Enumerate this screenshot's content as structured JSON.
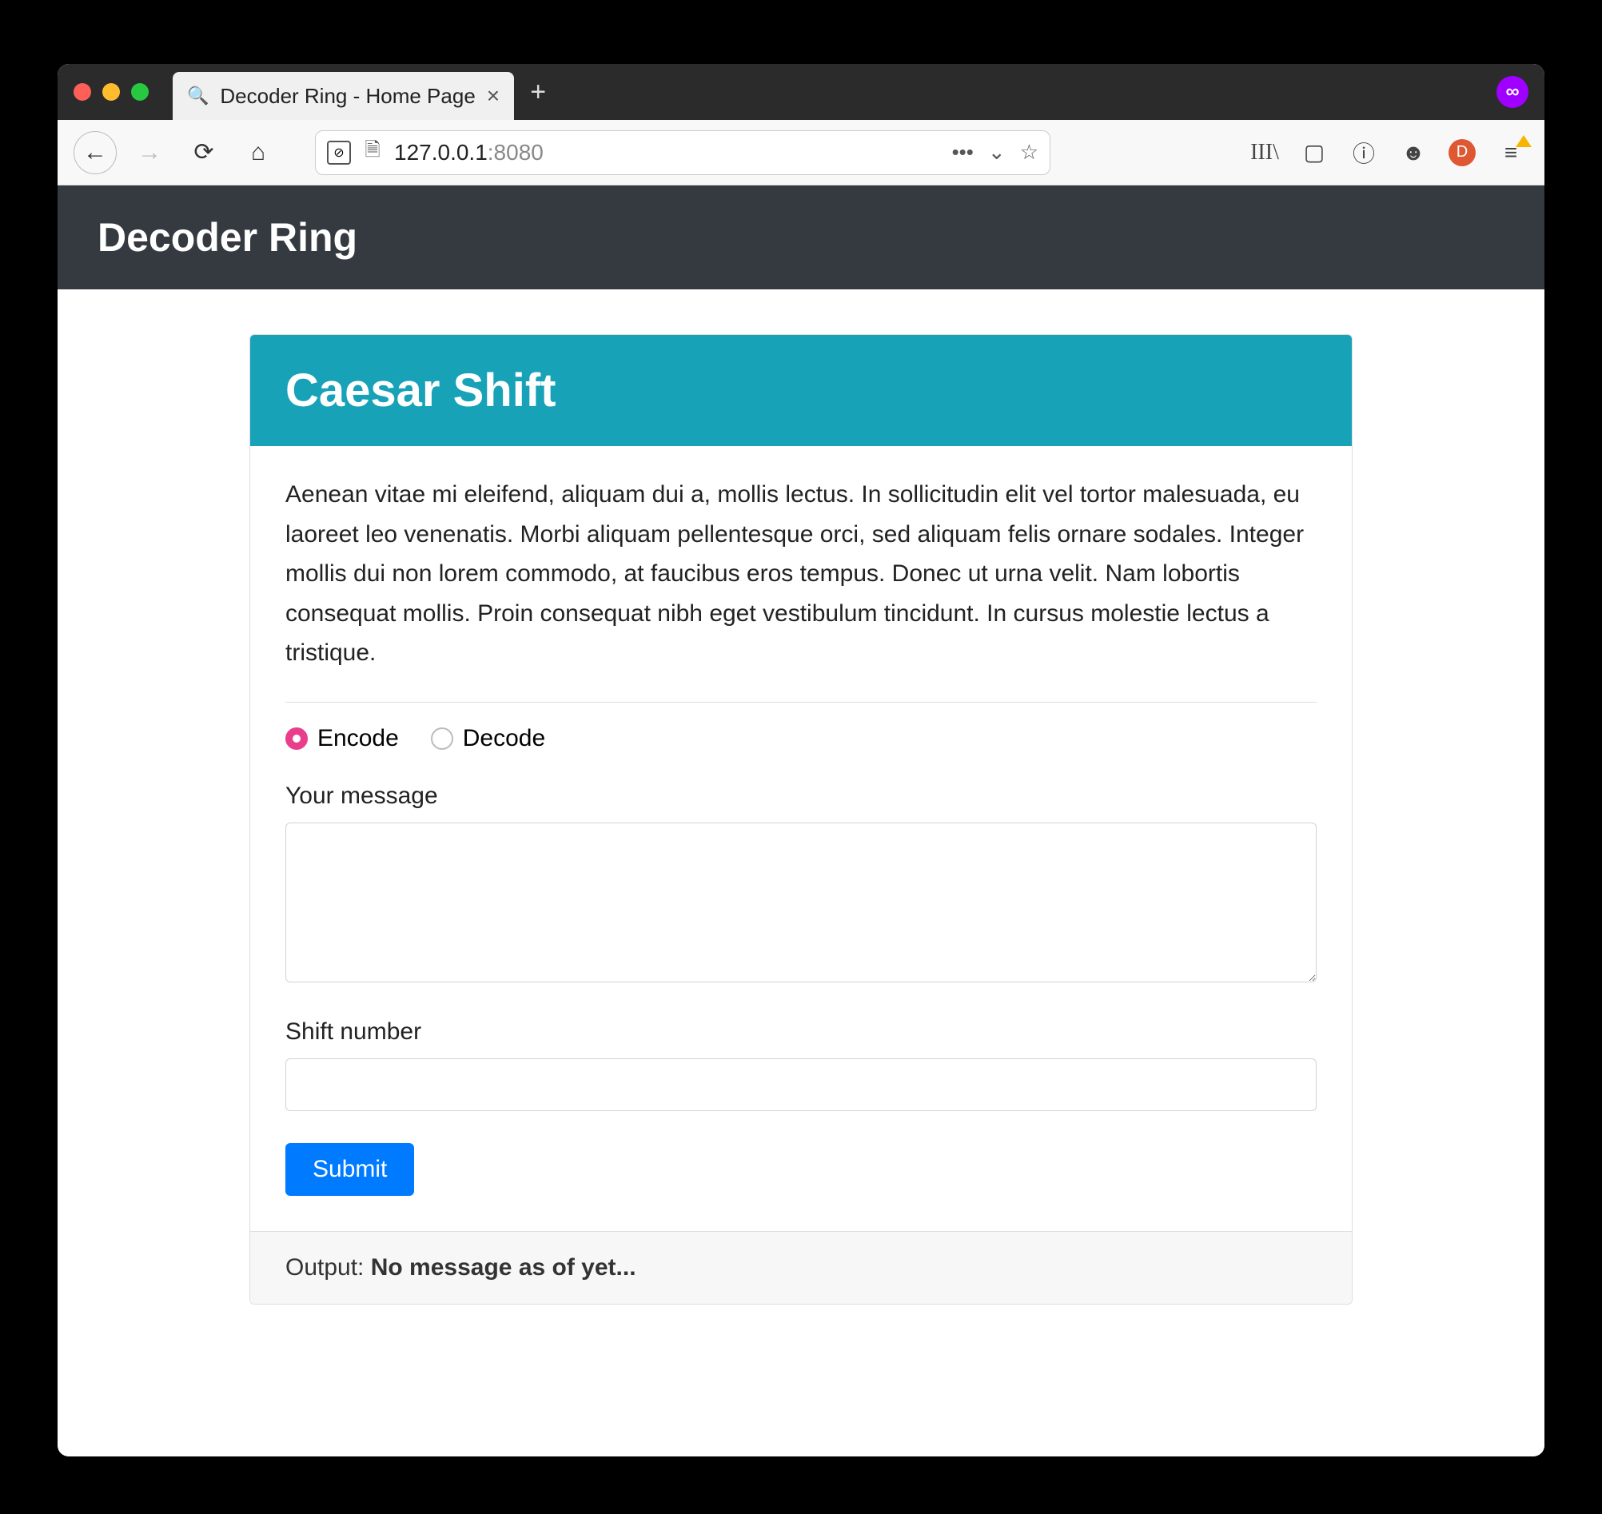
{
  "browser": {
    "tab_title": "Decoder Ring - Home Page",
    "url_host": "127.0.0.1",
    "url_port": ":8080"
  },
  "page": {
    "brand": "Decoder Ring",
    "card": {
      "title": "Caesar Shift",
      "description": "Aenean vitae mi eleifend, aliquam dui a, mollis lectus. In sollicitudin elit vel tortor malesuada, eu laoreet leo venenatis. Morbi aliquam pellentesque orci, sed aliquam felis ornare sodales. Integer mollis dui non lorem commodo, at faucibus eros tempus. Donec ut urna velit. Nam lobortis consequat mollis. Proin consequat nibh eget vestibulum tincidunt. In cursus molestie lectus a tristique.",
      "radios": {
        "encode": "Encode",
        "decode": "Decode"
      },
      "labels": {
        "message": "Your message",
        "shift": "Shift number"
      },
      "submit": "Submit",
      "output_label": "Output: ",
      "output_value": "No message as of yet..."
    }
  }
}
